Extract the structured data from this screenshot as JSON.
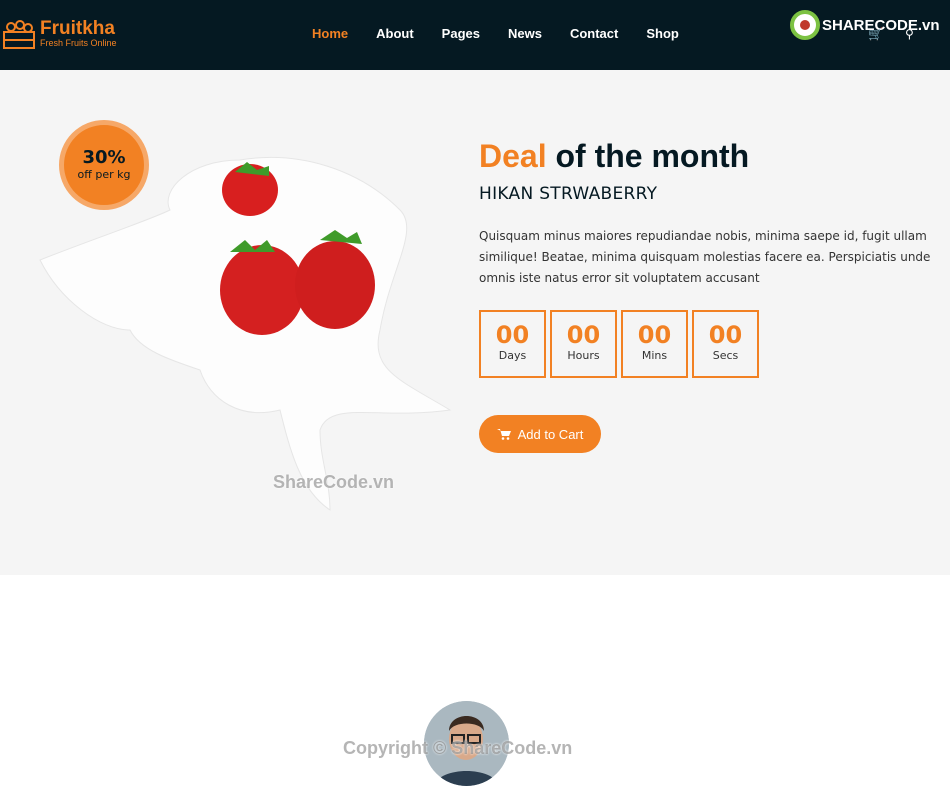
{
  "brand": {
    "name": "Fruitkha",
    "tagline": "Fresh Fruits Online",
    "accent": "#f28123",
    "nav_bg": "#051922"
  },
  "nav": {
    "items": [
      {
        "label": "Home",
        "active": true
      },
      {
        "label": "About"
      },
      {
        "label": "Pages"
      },
      {
        "label": "News"
      },
      {
        "label": "Contact"
      },
      {
        "label": "Shop"
      }
    ],
    "icons": [
      "cart-icon",
      "search-icon"
    ]
  },
  "watermark_logo": "SHARECODE.vn",
  "deal": {
    "badge_percent": "30%",
    "badge_text": "off per kg",
    "title_highlight": "Deal",
    "title_rest": "of the month",
    "product": "HIKAN STRWABERRY",
    "description": "Quisquam minus maiores repudiandae nobis, minima saepe id, fugit ullam similique! Beatae, minima quisquam molestias facere ea. Perspiciatis unde omnis iste natus error sit voluptatem accusant",
    "timer": [
      {
        "value": "00",
        "label": "Days"
      },
      {
        "value": "00",
        "label": "Hours"
      },
      {
        "value": "00",
        "label": "Mins"
      },
      {
        "value": "00",
        "label": "Secs"
      }
    ],
    "cart_label": "Add to Cart"
  },
  "watermarks": {
    "center": "ShareCode.vn",
    "footer": "Copyright © ShareCode.vn"
  }
}
